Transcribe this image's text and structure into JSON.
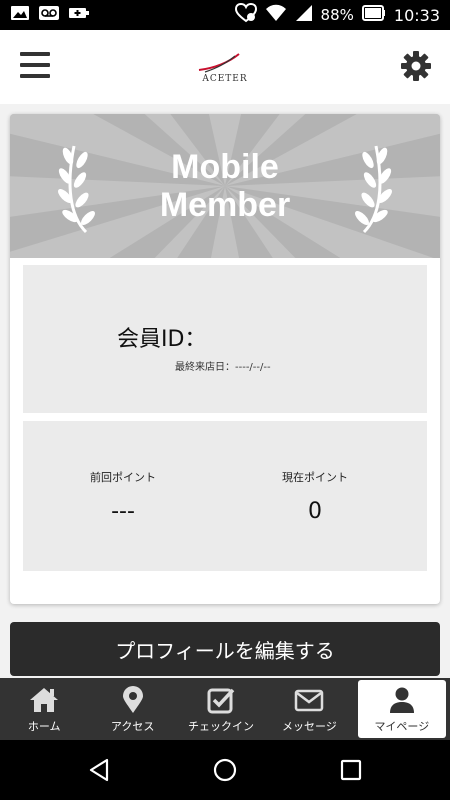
{
  "status_bar": {
    "battery": "88%",
    "time": "10:33",
    "icons": [
      "image-icon",
      "voicemail-icon",
      "battery-saver-icon",
      "heart-icon",
      "wifi-icon",
      "signal-icon",
      "battery-icon"
    ]
  },
  "header": {
    "logo_text": "ACETER",
    "menu_icon": "hamburger-menu-icon",
    "settings_icon": "gear-icon"
  },
  "member_card": {
    "banner_title_line1": "Mobile",
    "banner_title_line2": "Member",
    "member_id_label": "会員ID：",
    "last_visit": "最終来店日：----/--/--",
    "previous_points_label": "前回ポイント",
    "previous_points_value": "---",
    "current_points_label": "現在ポイント",
    "current_points_value": "0"
  },
  "edit_profile_button": "プロフィールを編集する",
  "tabs": [
    {
      "label": "ホーム",
      "icon": "home-icon"
    },
    {
      "label": "アクセス",
      "icon": "map-pin-icon"
    },
    {
      "label": "チェックイン",
      "icon": "checkbox-icon"
    },
    {
      "label": "メッセージ",
      "icon": "envelope-icon"
    },
    {
      "label": "マイページ",
      "icon": "person-icon"
    }
  ],
  "colors": {
    "banner": "#b3b3b3",
    "dark": "#333333",
    "button": "#2b2b2b"
  }
}
